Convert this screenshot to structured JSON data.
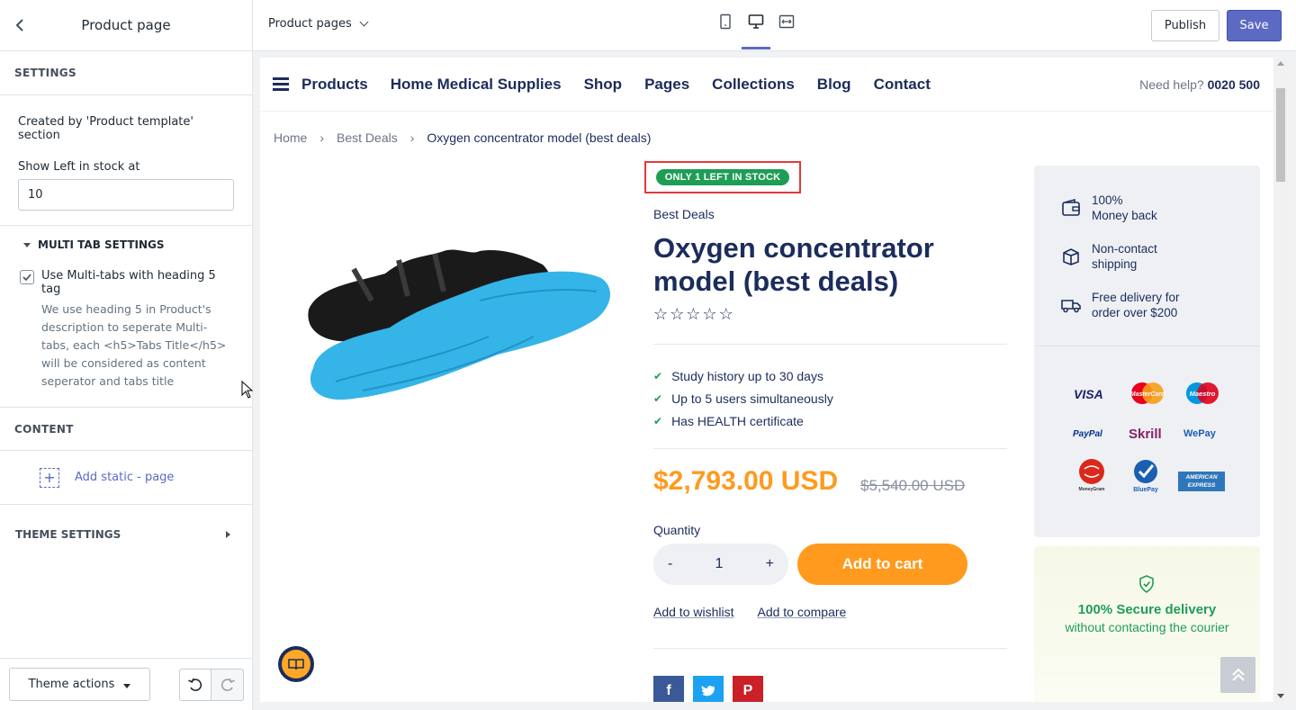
{
  "sidebar": {
    "title": "Product page",
    "settings_heading": "SETTINGS",
    "created_by": "Created by 'Product template' section",
    "stock_label": "Show Left in stock at",
    "stock_value": "10",
    "multi_tab_heading": "MULTI TAB SETTINGS",
    "multi_tab_checkbox_label": "Use Multi-tabs with heading 5 tag",
    "multi_tab_checked": true,
    "multi_tab_help": "We use heading 5 in Product's description to seperate Multi-tabs, each <h5>Tabs Title</h5> will be considered as content seperator and tabs title",
    "content_heading": "CONTENT",
    "add_static_label": "Add static - page",
    "theme_settings_heading": "THEME SETTINGS",
    "theme_actions_label": "Theme actions"
  },
  "topbar": {
    "page_selector": "Product pages",
    "publish_label": "Publish",
    "save_label": "Save",
    "active_device": "desktop"
  },
  "store": {
    "nav": [
      "Products",
      "Home Medical Supplies",
      "Shop",
      "Pages",
      "Collections",
      "Blog",
      "Contact"
    ],
    "help_text": "Need help?",
    "help_phone": "0020 500",
    "breadcrumb": [
      "Home",
      "Best Deals",
      "Oxygen concentrator model (best deals)"
    ],
    "stock_badge": "ONLY 1 LEFT IN STOCK",
    "vendor": "Best Deals",
    "product_title": "Oxygen concentrator model (best deals)",
    "rating": 0,
    "rating_max": 5,
    "features": [
      "Study history up to 30 days",
      "Up to 5 users simultaneously",
      "Has HEALTH certificate"
    ],
    "price": "$2,793.00 USD",
    "compare_price": "$5,540.00 USD",
    "quantity_label": "Quantity",
    "quantity_value": "1",
    "qty_minus": "-",
    "qty_plus": "+",
    "add_to_cart": "Add to cart",
    "add_to_wishlist": "Add to wishlist",
    "add_to_compare": "Add to compare",
    "perks": [
      {
        "line1": "100%",
        "line2": "Money back",
        "icon": "wallet-icon"
      },
      {
        "line1": "Non-contact",
        "line2": "shipping",
        "icon": "box-icon"
      },
      {
        "line1": "Free delivery for",
        "line2": "order over $200",
        "icon": "truck-icon"
      }
    ],
    "payments": [
      "VISA",
      "MasterCard",
      "Maestro",
      "PayPal",
      "Skrill",
      "WePay",
      "MoneyGram",
      "BluePay",
      "AMERICAN EXPRESS"
    ],
    "secure_title": "100% Secure delivery",
    "secure_sub": "without contacting the courier",
    "social": [
      "facebook-icon",
      "twitter-icon",
      "pinterest-icon"
    ]
  },
  "colors": {
    "brand_navy": "#1c2c5b",
    "accent_orange": "#ff9a1f",
    "stock_green": "#1f9d55",
    "save_purple": "#5c6ac4",
    "highlight_red": "#e53935"
  }
}
